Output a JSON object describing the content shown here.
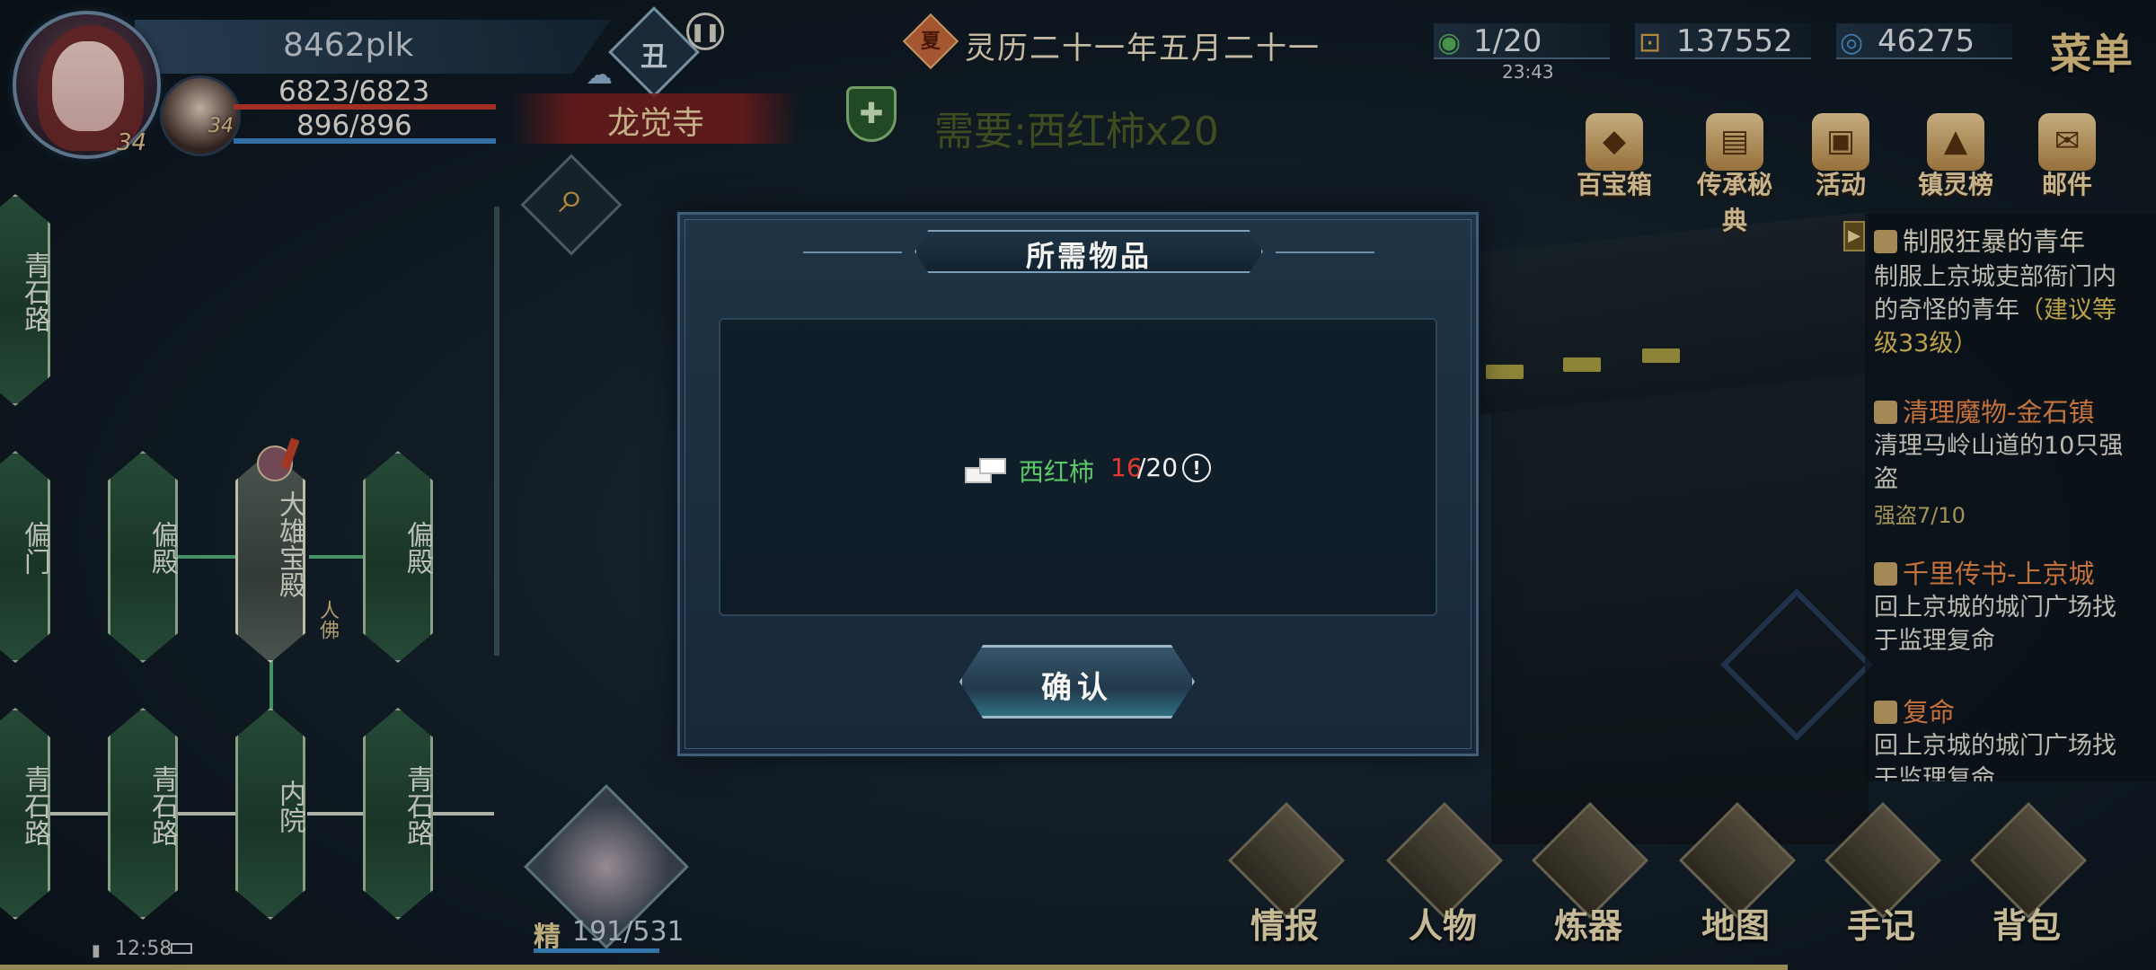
{
  "player": {
    "name": "8462plk",
    "level": "34",
    "companion_level": "34",
    "hp": "6823/6823",
    "mp": "896/896"
  },
  "hud": {
    "time_of_day": "丑",
    "location": "龙觉寺",
    "date_icon": "夏",
    "date": "灵历二十一年五月二十一",
    "quest_need": "需要:西红柿x20"
  },
  "resources": {
    "stamina": "1/20",
    "stamina_timer": "23:43",
    "coins": "137552",
    "jade": "46275",
    "menu": "菜单"
  },
  "top_icons": [
    {
      "label": "百宝箱",
      "icon": "treasure-chest-icon"
    },
    {
      "label": "传承秘典",
      "icon": "book-icon"
    },
    {
      "label": "活动",
      "icon": "gift-icon"
    },
    {
      "label": "镇灵榜",
      "icon": "pagoda-icon"
    },
    {
      "label": "邮件",
      "icon": "mail-icon"
    }
  ],
  "tasks": [
    {
      "title": "制服狂暴的青年",
      "desc": "制服上京城吏部衙门内的奇怪的青年",
      "hint": "（建议等级33级）"
    },
    {
      "title": "清理魔物-金石镇",
      "desc": "清理马岭山道的10只强盗",
      "progress": "强盗7/10"
    },
    {
      "title": "千里传书-上京城",
      "desc": "回上京城的城门广场找于监理复命"
    },
    {
      "title": "复命",
      "desc": "回上京城的城门广场找于监理复命"
    }
  ],
  "map": {
    "nodes": [
      "青石路",
      "偏门",
      "偏殿",
      "大雄宝殿",
      "偏殿",
      "青石路",
      "青石路",
      "内院",
      "青石路"
    ],
    "npc_tag": "人佛"
  },
  "pet": {
    "stat_icon": "精",
    "stat": "191/531"
  },
  "status": {
    "time": "12:58"
  },
  "bottom_menu": [
    "情报",
    "人物",
    "炼器",
    "地图",
    "手记",
    "背包"
  ],
  "dialog": {
    "title": "所需物品",
    "item_name": "西红柿",
    "have": "16",
    "need": "/20",
    "info": "!",
    "confirm": "确认"
  },
  "colors": {
    "item_name": "#5cc86a",
    "insufficient": "#e23b2e",
    "hp_bar": "#c63a2d",
    "mp_bar": "#3e86c8"
  }
}
